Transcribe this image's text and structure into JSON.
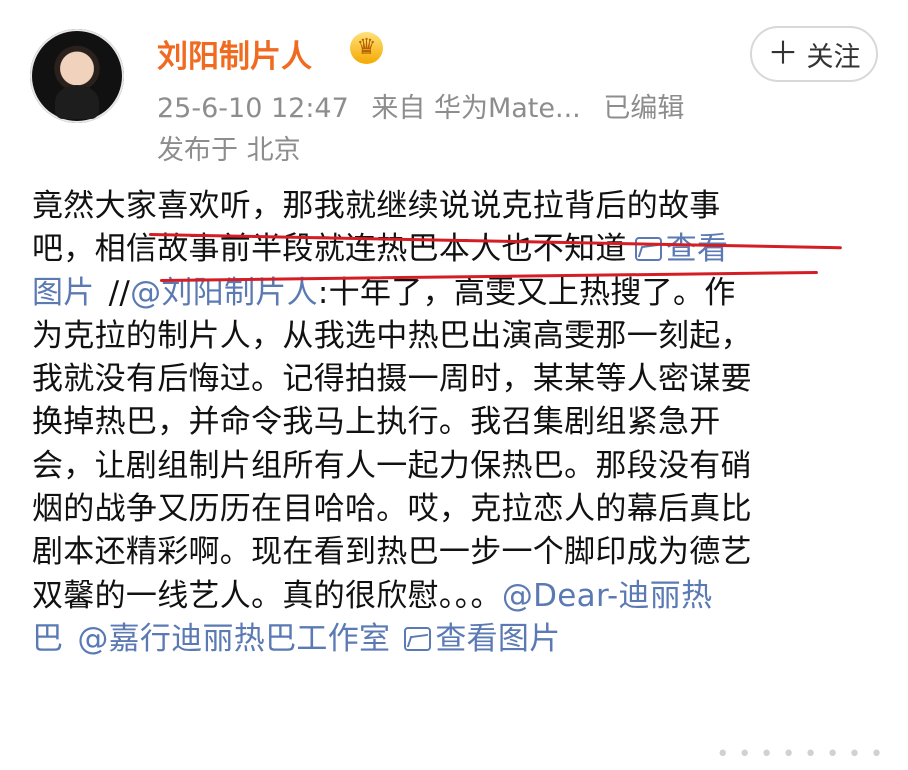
{
  "post": {
    "author": "刘阳制片人",
    "vip_badge": "♛",
    "timestamp": "25-6-10 12:47",
    "source": "来自 华为Mate...",
    "edited": "已编辑",
    "location": "发布于 北京",
    "follow_label": "关注",
    "follow_icon": "plus-icon"
  },
  "content": {
    "line1": "竟然大家喜欢听，那我就继续说说克拉背后的故事",
    "line2a": "吧，相信故事前半段就连热巴本人也不知道",
    "view_image_1": "查看",
    "line3a": "图片",
    "repost_prefix": "//",
    "mention_author": "@刘阳制片人",
    "line3b": ":十年了，高雯又上热搜了。作",
    "line4": "为克拉的制片人，从我选中热巴出演高雯那一刻起，",
    "line5": "我就没有后悔过。记得拍摄一周时，某某等人密谋要",
    "line6": "换掉热巴，并命令我马上执行。我召集剧组紧急开",
    "line7": "会，让剧组制片组所有人一起力保热巴。那段没有硝",
    "line8": "烟的战争又历历在目哈哈。哎，克拉恋人的幕后真比",
    "line9": "剧本还精彩啊。现在看到热巴一步一个脚印成为德艺",
    "line10a": "双馨的一线艺人。真的很欣慰。。。",
    "mention_dear": "@Dear-迪丽热",
    "line11a": "巴",
    "mention_studio": "@嘉行迪丽热巴工作室",
    "view_image_2": "查看图片"
  },
  "footer": {
    "more": "• • • • • • • •"
  },
  "colors": {
    "name": "#f06a1f",
    "link": "#5b7ab4",
    "underline": "#d51d24",
    "meta": "#8d8d8d"
  }
}
